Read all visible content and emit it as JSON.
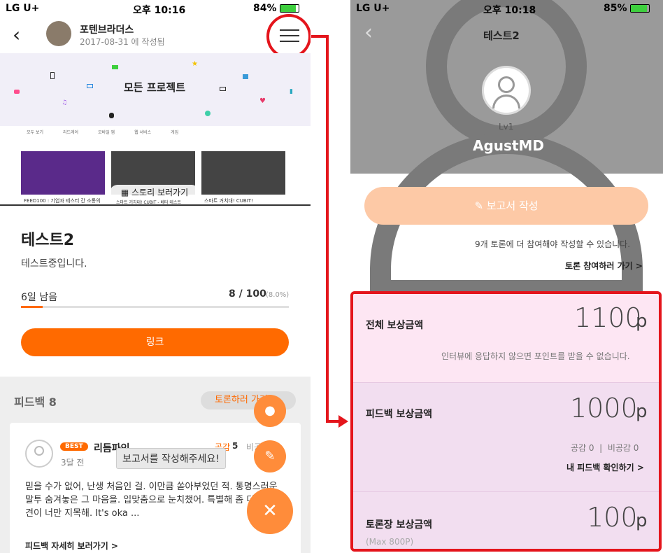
{
  "left": {
    "status": {
      "carrier": "LG U+",
      "time": "오후 10:16",
      "battery": "84%"
    },
    "header": {
      "name": "포텐브라더스",
      "date": "2017-08-31 에 작성됨"
    },
    "banner": {
      "title": "모든 프로젝트",
      "tabs": [
        "모두 보기",
        "리드레어",
        "모바일 앱",
        "웹 서비스",
        "게임"
      ],
      "story_btn": "스토리 보러가기",
      "captions": [
        "FEED100 : 기업과 테스터 간 소통의",
        "스마트 거치대! CUBIT - 베타 테스트",
        "스마트 거치대! CUBIT!"
      ]
    },
    "project": {
      "title": "테스트2",
      "desc": "테스트중입니다.",
      "remaining": "6일 남음",
      "count": "8 / 100",
      "pct": "(8.0%)",
      "progress": 0.08,
      "link_btn": "링크"
    },
    "feedback": {
      "header": "피드백 8",
      "discuss_btn": "토론하러 가기",
      "best": "BEST",
      "user": "리듬파인",
      "time": "3달 전",
      "like": "공감",
      "like_n": "5",
      "dislike": "비공감",
      "body": "믿을 수가 없어, 난생 처음인 걸. 이만큼 쏟아부었던 적. 통명스러운 말투 숨겨놓은 그 마음을. 입맞춤으로 눈치챘어. 특별해 좀 더 온갖 참견이 너만 지목해. It's oka ...",
      "detail": "피드백 자세히 보러가기 >",
      "toast": "보고서를 작성해주세요!"
    }
  },
  "right": {
    "status": {
      "carrier": "LG U+",
      "time": "오후 10:18",
      "battery": "85%"
    },
    "title": "테스트2",
    "level": "Lv1",
    "username": "AgustMD",
    "report_btn": "보고서 작성",
    "notice": "9개 토론에 더 참여해야 작성할 수 있습니다.",
    "join_link": "토론 참여하러 가기 >",
    "rewards": [
      {
        "label": "전체 보상금액",
        "value": "1100",
        "unit": "p",
        "note": "인터뷰에 응답하지 않으면 포인트를 받을 수 없습니다."
      },
      {
        "label": "피드백 보상금액",
        "value": "1000",
        "unit": "p",
        "stats": "공감 0  |  비공감 0",
        "link": "내 피드백 확인하기 >"
      },
      {
        "label": "토론장 보상금액",
        "value": "100",
        "unit": "p",
        "sub": "(Max 800P)"
      }
    ]
  },
  "colors": {
    "orange": "#ff6a00",
    "peach": "#fdc9a6",
    "red": "#e4151c",
    "pink1": "#fde6f3",
    "pink2": "#f2def0"
  }
}
